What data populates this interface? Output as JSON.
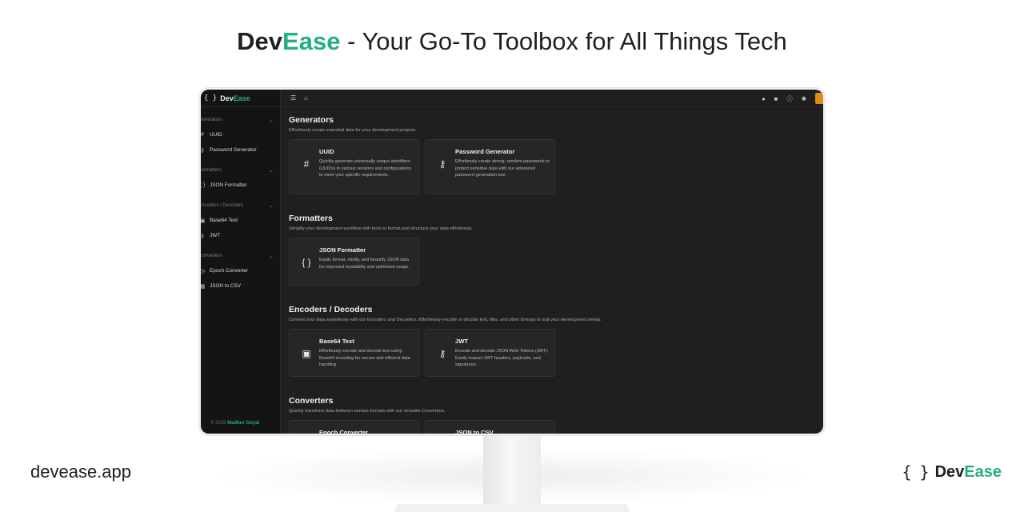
{
  "headline": {
    "brand_dev": "Dev",
    "brand_ease": "Ease",
    "sep": " - ",
    "tagline": " Your Go-To Toolbox for All Things Tech"
  },
  "footer": {
    "site": "devease.app",
    "brand_braces": "{ }",
    "brand_dev": "Dev",
    "brand_ease": "Ease"
  },
  "colors": {
    "accent": "#22b07d",
    "app_bg": "#1f1f1f",
    "sidebar_bg": "#141414",
    "card_bg": "#262626"
  },
  "app": {
    "logo": {
      "braces": "{ }",
      "dev": "Dev",
      "ease": "Ease"
    },
    "sidebar": {
      "groups": [
        {
          "label": "Generators",
          "items": [
            {
              "icon": "hash-icon",
              "label": "UUID"
            },
            {
              "icon": "key-icon",
              "label": "Password Generator"
            }
          ]
        },
        {
          "label": "Formatters",
          "items": [
            {
              "icon": "braces-icon",
              "label": "JSON Formatter"
            }
          ]
        },
        {
          "label": "Encoders / Decoders",
          "items": [
            {
              "icon": "file-icon",
              "label": "Base64 Text"
            },
            {
              "icon": "key-icon",
              "label": "JWT"
            }
          ]
        },
        {
          "label": "Converters",
          "items": [
            {
              "icon": "clock-icon",
              "label": "Epoch Converter"
            },
            {
              "icon": "table-icon",
              "label": "JSON to CSV"
            }
          ]
        }
      ],
      "footer_copy": "© 2025 ",
      "footer_name": "Madhur Goyal"
    },
    "topbar": {
      "left_icons": [
        "menu-icon",
        "home-icon"
      ],
      "right_icons": [
        "github-icon",
        "linkedin-icon",
        "info-icon",
        "lightbulb-icon"
      ]
    },
    "sections": [
      {
        "title": "Generators",
        "desc": "Effortlessly create essential data for your development projects.",
        "cards": [
          {
            "icon": "hash-icon",
            "title": "UUID",
            "desc": "Quickly generate universally unique identifiers (UUIDs) in various versions and configurations to meet your specific requirements."
          },
          {
            "icon": "key-icon",
            "title": "Password Generator",
            "desc": "Effortlessly create strong, random passwords to protect sensitive data with our advanced password generation tool."
          }
        ]
      },
      {
        "title": "Formatters",
        "desc": "Simplify your development workflow with tools to format and structure your data effortlessly.",
        "cards": [
          {
            "icon": "braces-icon",
            "title": "JSON Formatter",
            "desc": "Easily format, minify, and beautify JSON data for improved readability and optimized usage."
          }
        ]
      },
      {
        "title": "Encoders / Decoders",
        "desc": "Convert your data seamlessly with our Encoders and Decoders. Effortlessly encode or decode text, files, and other formats to suit your development needs.",
        "cards": [
          {
            "icon": "file-icon",
            "title": "Base64 Text",
            "desc": "Effortlessly encode and decode text using Base64 encoding for secure and efficient data handling."
          },
          {
            "icon": "key-icon",
            "title": "JWT",
            "desc": "Encode and decode JSON Web Tokens (JWT). Easily inspect JWT headers, payloads, and signatures."
          }
        ]
      },
      {
        "title": "Converters",
        "desc": "Quickly transform data between various formats with our versatile Converters.",
        "cards": [
          {
            "icon": "clock-icon",
            "title": "Epoch Converter",
            "desc": ""
          },
          {
            "icon": "table-icon",
            "title": "JSON to CSV",
            "desc": ""
          }
        ]
      }
    ]
  }
}
